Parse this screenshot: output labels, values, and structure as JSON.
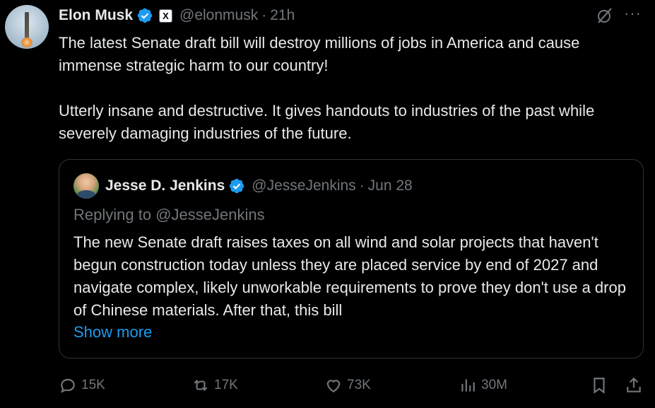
{
  "author": {
    "name": "Elon Musk",
    "handle": "@elonmusk",
    "separator": "·",
    "time": "21h",
    "affiliation_badge": "X"
  },
  "tweet": {
    "text": "The latest Senate draft bill will destroy millions of jobs in America and cause immense strategic harm to our country!\n\nUtterly insane and destructive. It gives handouts to industries of the past while severely damaging industries of the future."
  },
  "quote": {
    "name": "Jesse D. Jenkins",
    "handle": "@JesseJenkins",
    "separator": "·",
    "time": "Jun 28",
    "replying": "Replying to @JesseJenkins",
    "text": "The new Senate draft raises taxes on all wind and solar projects that haven't begun construction today unless they are placed service by end of 2027 and navigate complex, likely unworkable requirements to prove they don't use a drop of Chinese materials. After that, this bill",
    "show_more": "Show more"
  },
  "header_actions": {
    "more": "···"
  },
  "actions": {
    "replies": "15K",
    "reposts": "17K",
    "likes": "73K",
    "views": "30M"
  },
  "colors": {
    "background": "#000000",
    "text": "#e7e9ea",
    "secondary": "#71767b",
    "link": "#1d9bf0",
    "verified": "#1d9bf0",
    "border": "#2f3336"
  }
}
